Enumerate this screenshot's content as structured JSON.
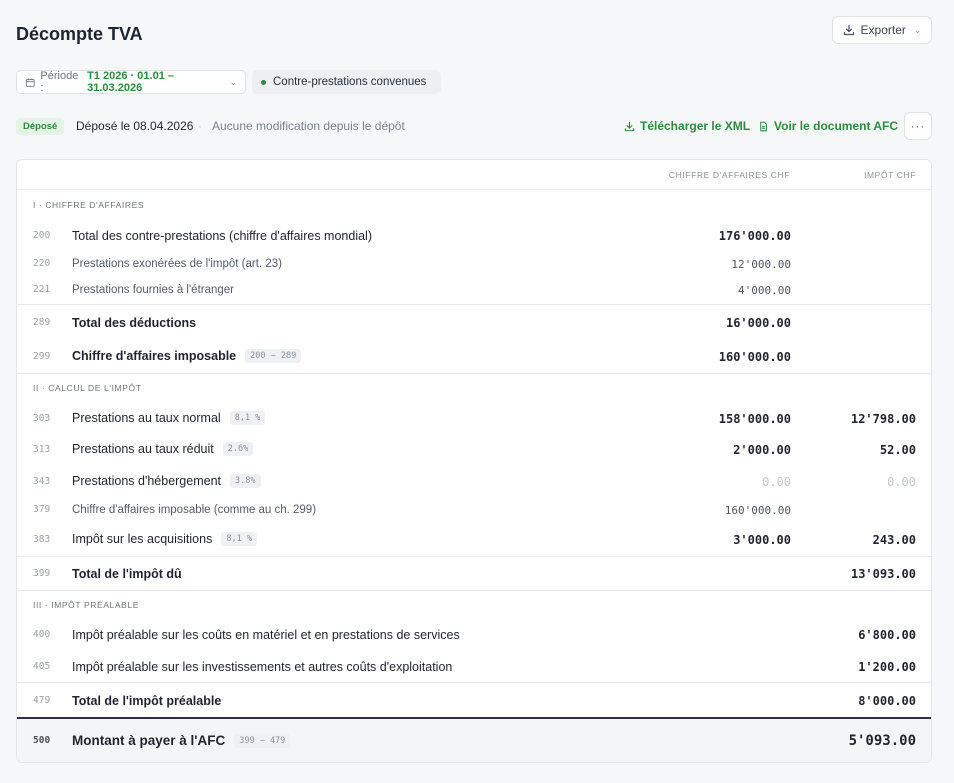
{
  "header": {
    "title": "Décompte TVA",
    "export_label": "Exporter"
  },
  "filters": {
    "period_label": "Période :",
    "period_value": "T1 2026 · 01.01 – 31.03.2026",
    "mode_label": "Contre-prestations convenues"
  },
  "status": {
    "badge": "Déposé",
    "date": "Déposé le 08.04.2026",
    "separator": "·",
    "note": "Aucune modification depuis le dépôt",
    "download_xml": "Télécharger le XML",
    "view_document": "Voir le document AFC",
    "more": "···"
  },
  "table": {
    "col_ca": "CHIFFRE D'AFFAIRES CHF",
    "col_imp": "IMPÔT CHF",
    "sections": {
      "s1": "I · CHIFFRE D'AFFAIRES",
      "s2": "II · CALCUL DE L'IMPÔT",
      "s3": "III · IMPÔT PRÉALABLE"
    },
    "rows": {
      "r200": {
        "code": "200",
        "label": "Total des contre-prestations (chiffre d'affaires mondial)",
        "ca": "176'000.00"
      },
      "r220": {
        "code": "220",
        "label": "Prestations exonérées de l'impôt (art. 23)",
        "ca": "12'000.00"
      },
      "r221": {
        "code": "221",
        "label": "Prestations fournies à l'étranger",
        "ca": "4'000.00"
      },
      "r289": {
        "code": "289",
        "label": "Total des déductions",
        "ca": "16'000.00"
      },
      "r299": {
        "code": "299",
        "label": "Chiffre d'affaires imposable",
        "tag": "200 − 289",
        "ca": "160'000.00"
      },
      "r303": {
        "code": "303",
        "label": "Prestations au taux normal",
        "tag": "8,1 %",
        "ca": "158'000.00",
        "imp": "12'798.00"
      },
      "r313": {
        "code": "313",
        "label": "Prestations au taux réduit",
        "tag": "2.6%",
        "ca": "2'000.00",
        "imp": "52.00"
      },
      "r343": {
        "code": "343",
        "label": "Prestations d'hébergement",
        "tag": "3.8%",
        "ca": "0.00",
        "imp": "0.00"
      },
      "r379": {
        "code": "379",
        "label": "Chiffre d'affaires imposable (comme au ch. 299)",
        "ca": "160'000.00"
      },
      "r383": {
        "code": "383",
        "label": "Impôt sur les acquisitions",
        "tag": "8,1 %",
        "ca": "3'000.00",
        "imp": "243.00"
      },
      "r399": {
        "code": "399",
        "label": "Total de l'impôt dû",
        "imp": "13'093.00"
      },
      "r400": {
        "code": "400",
        "label": "Impôt préalable sur les coûts en matériel et en prestations de services",
        "imp": "6'800.00"
      },
      "r405": {
        "code": "405",
        "label": "Impôt préalable sur les investissements et autres coûts d'exploitation",
        "imp": "1'200.00"
      },
      "r479": {
        "code": "479",
        "label": "Total de l'impôt préalable",
        "imp": "8'000.00"
      },
      "r500": {
        "code": "500",
        "label": "Montant à payer à l'AFC",
        "tag": "399 − 479",
        "imp": "5'093.00"
      }
    }
  },
  "colors": {
    "accent_green": "#2e8a3e",
    "total_rule": "#2a3144"
  }
}
